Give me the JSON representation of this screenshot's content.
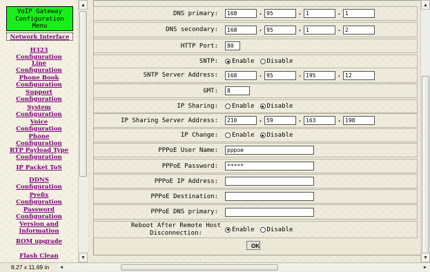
{
  "nav": {
    "title_lines": [
      "VoIP Gateway",
      "Configuration",
      "Menu"
    ],
    "active_item": "Network Interface",
    "items": [
      {
        "lines": [
          "H323",
          "Configuration"
        ]
      },
      {
        "lines": [
          "Line",
          "Configuration"
        ]
      },
      {
        "lines": [
          "Phone Book",
          "Configuration"
        ]
      },
      {
        "lines": [
          "Support",
          "Configuration"
        ]
      },
      {
        "lines": [
          "System",
          "Configuration"
        ]
      },
      {
        "lines": [
          "Voice",
          "Configuration"
        ]
      },
      {
        "lines": [
          "Phone",
          "Configuration"
        ]
      },
      {
        "lines": [
          "RTP Payload Type",
          "Configuration"
        ]
      },
      {
        "lines": [
          "IP Packet ToS"
        ]
      },
      {
        "lines": [
          "DDNS",
          "Configuration"
        ]
      },
      {
        "lines": [
          "Prefix",
          "Configuration"
        ]
      },
      {
        "lines": [
          "Password",
          "Configuration"
        ]
      },
      {
        "lines": [
          "Version and",
          "Information"
        ]
      },
      {
        "lines": [
          "ROM upgrade"
        ]
      },
      {
        "lines": [
          "Flash Clean"
        ]
      }
    ]
  },
  "form": {
    "dns_primary": {
      "label": "DNS primary:",
      "octets": [
        "168",
        "95",
        "1",
        "1"
      ]
    },
    "dns_secondary": {
      "label": "DNS secondary:",
      "octets": [
        "168",
        "95",
        "1",
        "2"
      ]
    },
    "http_port": {
      "label": "HTTP Port:",
      "value": "80"
    },
    "sntp": {
      "label": "SNTP:",
      "options": [
        "Enable",
        "Disable"
      ],
      "selected": "Enable"
    },
    "sntp_server": {
      "label": "SNTP Server Address:",
      "octets": [
        "168",
        "95",
        "195",
        "12"
      ]
    },
    "gmt": {
      "label": "GMT:",
      "value": "8"
    },
    "ip_sharing": {
      "label": "IP Sharing:",
      "options": [
        "Enable",
        "Disable"
      ],
      "selected": "Disable"
    },
    "ip_sharing_server": {
      "label": "IP Sharing Server Address:",
      "octets": [
        "210",
        "59",
        "163",
        "198"
      ]
    },
    "ip_change": {
      "label": "IP Change:",
      "options": [
        "Enable",
        "Disable"
      ],
      "selected": "Disable"
    },
    "pppoe_user": {
      "label": "PPPoE User Name:",
      "value": "pppoe"
    },
    "pppoe_password": {
      "label": "PPPoE Password:",
      "value": "*****"
    },
    "pppoe_ip": {
      "label": "PPPoE IP Address:",
      "value": ""
    },
    "pppoe_destination": {
      "label": "PPPoE Destination:",
      "value": ""
    },
    "pppoe_dns": {
      "label": "PPPoE DNS primary:",
      "value": ""
    },
    "reboot": {
      "label_lines": [
        "Reboot After Remote Host",
        "Disconnection:"
      ],
      "options": [
        "Enable",
        "Disable"
      ],
      "selected": "Enable"
    },
    "ok_label": "OK"
  },
  "status": {
    "page_size": "8.27 x 11.69 in"
  },
  "icons": [
    "scroll-up-icon",
    "scroll-down-icon",
    "scroll-left-icon",
    "scroll-right-icon"
  ]
}
